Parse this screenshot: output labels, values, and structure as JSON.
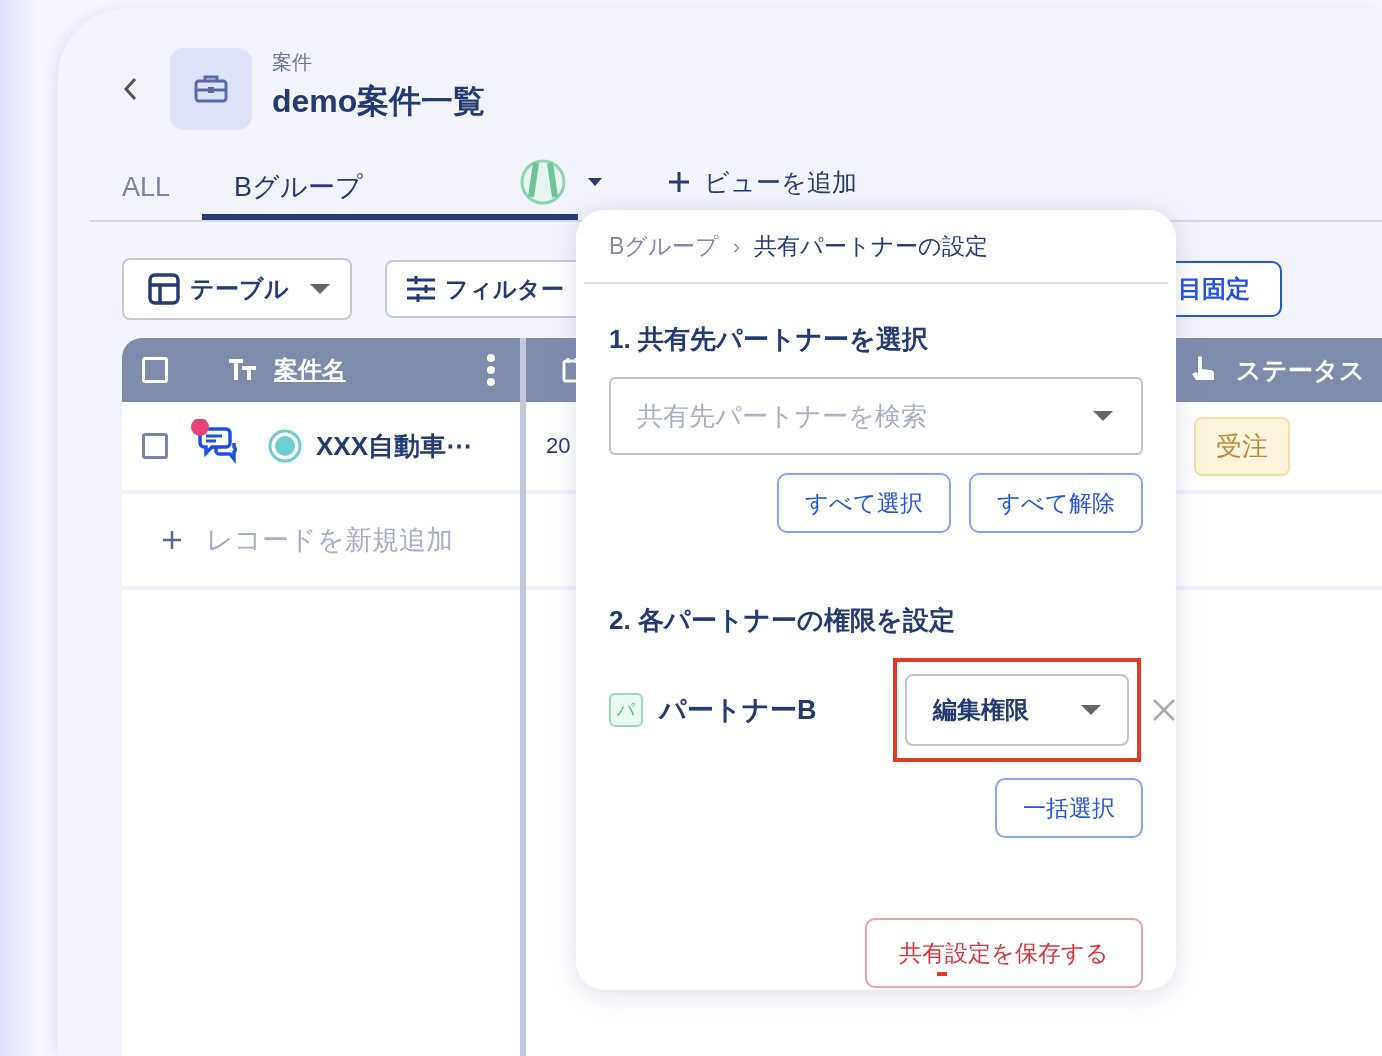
{
  "header": {
    "category": "案件",
    "title": "demo案件一覧"
  },
  "tabs": [
    {
      "label": "ALL",
      "selected": false
    },
    {
      "label": "Bグループ",
      "selected": true
    }
  ],
  "add_view": "ビューを追加",
  "toolbar": {
    "table_button": "テーブル",
    "filter_button": "フィルター",
    "pin_button": "目固定"
  },
  "table": {
    "header_checked": false,
    "name_column": "案件名",
    "status_column": "ステータス",
    "rows": [
      {
        "checked": false,
        "unread": true,
        "name": "XXX自動車⋯",
        "column_2": "20",
        "status": "受注"
      }
    ],
    "add_record": "レコードを新規追加"
  },
  "popup": {
    "breadcrumb": [
      "Bグループ",
      "共有パートナーの設定"
    ],
    "breadcrumb_separator": "›",
    "step1_title": "1. 共有先パートナーを選択",
    "search": {
      "placeholder": "共有先パートナーを検索"
    },
    "select_all": "すべて選択",
    "deselect_all": "すべて解除",
    "step2_title": "2. 各パートナーの権限を設定",
    "partners": [
      {
        "badge": "パ",
        "name": "パートナーB",
        "permission": "編集権限",
        "highlighted": true
      }
    ],
    "bulk_select": "一括選択",
    "save": "共有設定を保存する"
  }
}
